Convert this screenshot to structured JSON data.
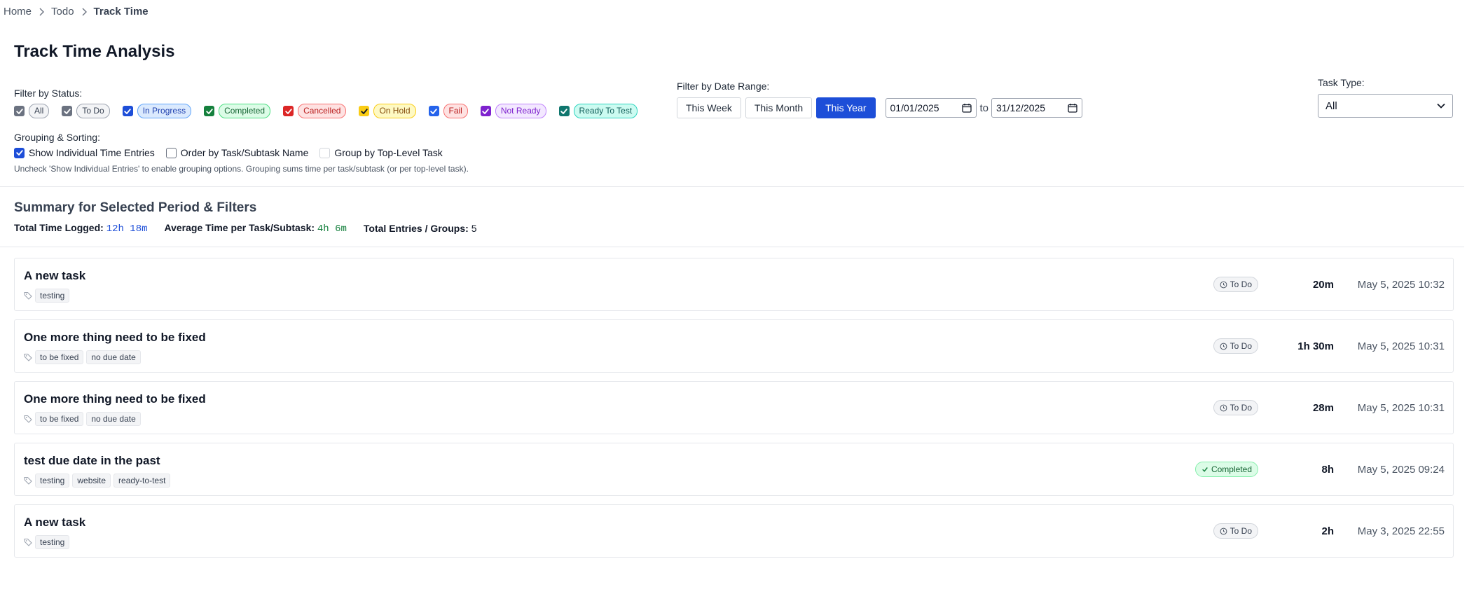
{
  "breadcrumb": {
    "items": [
      "Home",
      "Todo"
    ],
    "current": "Track Time"
  },
  "page_title": "Track Time Analysis",
  "filters": {
    "status_label": "Filter by Status:",
    "statuses": [
      {
        "label": "All",
        "checked": true,
        "box_color": "#6b7280",
        "bg": "#f3f4f6",
        "border": "#9ca3af",
        "text": "#374151"
      },
      {
        "label": "To Do",
        "checked": true,
        "box_color": "#6b7280",
        "bg": "#f3f4f6",
        "border": "#9ca3af",
        "text": "#374151"
      },
      {
        "label": "In Progress",
        "checked": true,
        "box_color": "#1d4ed8",
        "bg": "#dbeafe",
        "border": "#60a5fa",
        "text": "#1e40af"
      },
      {
        "label": "Completed",
        "checked": true,
        "box_color": "#15803d",
        "bg": "#dcfce7",
        "border": "#4ade80",
        "text": "#166534"
      },
      {
        "label": "Cancelled",
        "checked": true,
        "box_color": "#dc2626",
        "bg": "#fee2e2",
        "border": "#f87171",
        "text": "#b91c1c"
      },
      {
        "label": "On Hold",
        "checked": true,
        "box_color": "#facc15",
        "bg": "#fef9c3",
        "border": "#facc15",
        "text": "#854d0e"
      },
      {
        "label": "Fail",
        "checked": true,
        "box_color": "#2563eb",
        "bg": "#fee2e2",
        "border": "#f87171",
        "text": "#b91c1c"
      },
      {
        "label": "Not Ready",
        "checked": true,
        "box_color": "#7e22ce",
        "bg": "#f3e8ff",
        "border": "#c084fc",
        "text": "#7e22ce"
      },
      {
        "label": "Ready To Test",
        "checked": true,
        "box_color": "#0f766e",
        "bg": "#ccfbf1",
        "border": "#2dd4bf",
        "text": "#115e59"
      }
    ],
    "date_range_label": "Filter by Date Range:",
    "range_buttons": [
      {
        "label": "This Week",
        "active": false
      },
      {
        "label": "This Month",
        "active": false
      },
      {
        "label": "This Year",
        "active": true
      }
    ],
    "date_from": "01/01/2025",
    "date_to_separator": "to",
    "date_to": "31/12/2025",
    "task_type_label": "Task Type:",
    "task_type_value": "All"
  },
  "grouping": {
    "label": "Grouping & Sorting:",
    "options": [
      {
        "label": "Show Individual Time Entries",
        "checked": true,
        "disabled": false
      },
      {
        "label": "Order by Task/Subtask Name",
        "checked": false,
        "disabled": false
      },
      {
        "label": "Group by Top-Level Task",
        "checked": false,
        "disabled": true
      }
    ],
    "hint": "Uncheck 'Show Individual Entries' to enable grouping options. Grouping sums time per task/subtask (or per top-level task)."
  },
  "summary": {
    "title": "Summary for Selected Period & Filters",
    "total_label": "Total Time Logged:",
    "total_value": "12h 18m",
    "average_label": "Average Time per Task/Subtask:",
    "average_value": "4h 6m",
    "count_label": "Total Entries / Groups:",
    "count_value": "5",
    "colors": {
      "total": "#1d4ed8",
      "average": "#15803d"
    }
  },
  "entries": [
    {
      "title": "A new task",
      "tags": [
        "testing"
      ],
      "status": "To Do",
      "status_kind": "todo",
      "duration": "20m",
      "date": "May 5, 2025 10:32"
    },
    {
      "title": "One more thing need to be fixed",
      "tags": [
        "to be fixed",
        "no due date"
      ],
      "status": "To Do",
      "status_kind": "todo",
      "duration": "1h 30m",
      "date": "May 5, 2025 10:31"
    },
    {
      "title": "One more thing need to be fixed",
      "tags": [
        "to be fixed",
        "no due date"
      ],
      "status": "To Do",
      "status_kind": "todo",
      "duration": "28m",
      "date": "May 5, 2025 10:31"
    },
    {
      "title": "test due date in the past",
      "tags": [
        "testing",
        "website",
        "ready-to-test"
      ],
      "status": "Completed",
      "status_kind": "completed",
      "duration": "8h",
      "date": "May 5, 2025 09:24"
    },
    {
      "title": "A new task",
      "tags": [
        "testing"
      ],
      "status": "To Do",
      "status_kind": "todo",
      "duration": "2h",
      "date": "May 3, 2025 22:55"
    }
  ]
}
